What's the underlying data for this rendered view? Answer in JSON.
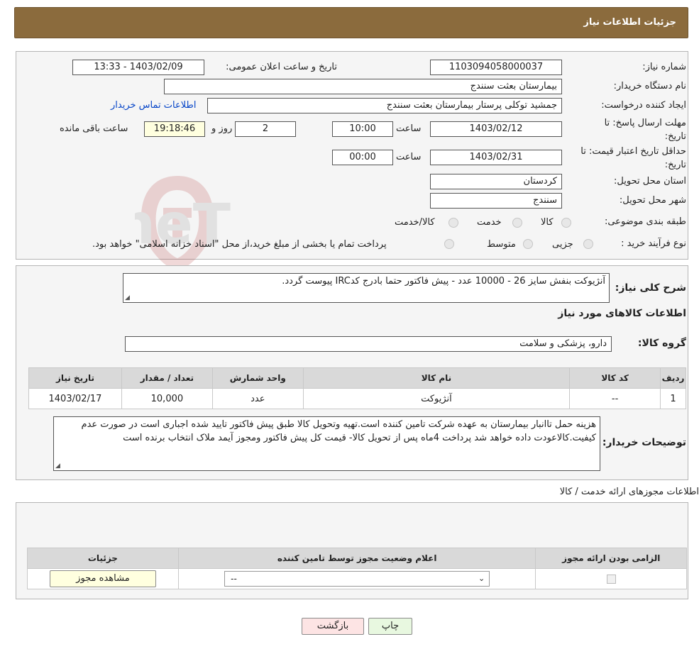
{
  "page_title": "جزئیات اطلاعات نیاز",
  "fields": {
    "need_number_label": "شماره نیاز:",
    "need_number": "1103094058000037",
    "announce_label": "تاریخ و ساعت اعلان عمومی:",
    "announce_value": "1403/02/09 - 13:33",
    "buyer_org_label": "نام دستگاه خریدار:",
    "buyer_org": "بیمارستان بعثت سنندج",
    "creator_label": "ایجاد کننده درخواست:",
    "creator": "جمشید  توکلی پرستار بیمارستان بعثت سنندج",
    "contact_link": "اطلاعات تماس خریدار",
    "deadline_label_1": "مهلت ارسال پاسخ: تا",
    "deadline_label_2": "تاریخ:",
    "deadline_date": "1403/02/12",
    "time_label": "ساعت",
    "deadline_time": "10:00",
    "days_value": "2",
    "days_label": "روز و",
    "remaining_time": "19:18:46",
    "remaining_label": "ساعت باقی مانده",
    "validity_label_1": "حداقل تاریخ اعتبار قیمت: تا",
    "validity_label_2": "تاریخ:",
    "validity_date": "1403/02/31",
    "validity_time": "00:00",
    "province_label": "استان محل تحویل:",
    "province": "کردستان",
    "city_label": "شهر محل تحویل:",
    "city": "سنندج",
    "category_label": "طبقه بندی موضوعی:",
    "category_options": [
      "کالا",
      "خدمت",
      "کالا/خدمت"
    ],
    "process_label": "نوع فرآیند خرید :",
    "process_options": [
      "جزیی",
      "متوسط"
    ],
    "process_note": "پرداخت تمام یا بخشی از مبلغ خرید،از محل \"اسناد خزانه اسلامی\" خواهد بود."
  },
  "description": {
    "label": "شرح کلی نیاز:",
    "value": "آنژیوکت بنفش سایز 26 - 10000 عدد - پیش فاکتور حتما بادرج کدIRC پیوست گردد."
  },
  "goods_section_title": "اطلاعات کالاهای مورد نیاز",
  "goods_group": {
    "label": "گروه کالا:",
    "value": "دارو، پزشکی و سلامت"
  },
  "goods_table": {
    "headers": [
      "ردیف",
      "کد کالا",
      "نام کالا",
      "واحد شمارش",
      "تعداد / مقدار",
      "تاریخ نیاز"
    ],
    "rows": [
      [
        "1",
        "--",
        "آنژیوکت",
        "عدد",
        "10,000",
        "1403/02/17"
      ]
    ]
  },
  "buyer_notes": {
    "label": "توضیحات خریدار:",
    "value": "هزینه حمل تاانبار بیمارستان به عهده شرکت تامین کننده است.تهیه وتحویل کالا طبق پیش فاکتور تایید شده اجباری است در صورت عدم کیفیت.کالاعودت داده خواهد شد پرداخت 4ماه پس از تحویل کالا- قیمت کل پیش فاکتور ومجوز آیمد ملاک انتخاب برنده است"
  },
  "licenses_title": "اطلاعات مجوزهای ارائه خدمت / کالا",
  "license_table": {
    "headers": [
      "الزامی بودن ارائه مجوز",
      "اعلام وضعیت مجوز توسط تامین کننده",
      "جزئیات"
    ],
    "select_value": "--",
    "view_button": "مشاهده مجوز"
  },
  "buttons": {
    "print": "چاپ",
    "back": "بازگشت"
  },
  "watermark_text": "AriaTender.neT"
}
